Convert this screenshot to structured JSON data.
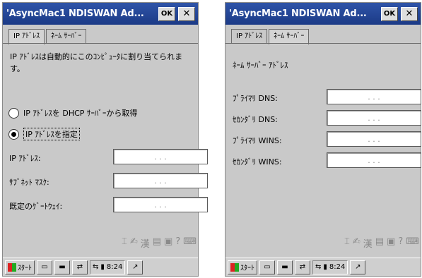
{
  "left": {
    "title": "'AsyncMac1 NDISWAN Ad...",
    "ok_label": "OK",
    "close_label": "✕",
    "tabs": [
      {
        "label": "IP ｱﾄﾞﾚｽ",
        "active": true
      },
      {
        "label": "ﾈｰﾑ ｻｰﾊﾞｰ",
        "active": false
      }
    ],
    "description": "IP ｱﾄﾞﾚｽは自動的にこのｺﾝﾋﾟｭｰﾀに割り当てられます。",
    "radio_dhcp": "IP ｱﾄﾞﾚｽを DHCP ｻｰﾊﾞｰから取得",
    "radio_specify": "IP ｱﾄﾞﾚｽを指定",
    "fields": [
      {
        "label": "IP ｱﾄﾞﾚｽ:"
      },
      {
        "label": "ｻﾌﾞﾈｯﾄ ﾏｽｸ:"
      },
      {
        "label": "既定のｹﾞｰﾄｳｪｲ:"
      }
    ]
  },
  "right": {
    "title": "'AsyncMac1 NDISWAN Ad...",
    "ok_label": "OK",
    "close_label": "✕",
    "tabs": [
      {
        "label": "IP ｱﾄﾞﾚｽ",
        "active": false
      },
      {
        "label": "ﾈｰﾑ ｻｰﾊﾞｰ",
        "active": true
      }
    ],
    "section_label": "ﾈｰﾑ ｻｰﾊﾞｰ ｱﾄﾞﾚｽ",
    "fields": [
      {
        "label": "ﾌﾟﾗｲﾏﾘ DNS:"
      },
      {
        "label": "ｾｶﾝﾀﾞﾘ DNS:"
      },
      {
        "label": "ﾌﾟﾗｲﾏﾘ WINS:"
      },
      {
        "label": "ｾｶﾝﾀﾞﾘ WINS:"
      }
    ]
  },
  "ip_dots": ".   .   .",
  "taskbar": {
    "start_label": "ｽﾀｰﾄ",
    "time": "8:24"
  },
  "icons": {
    "input_panel": "keyboard-icon",
    "tray": "connection-icon"
  }
}
